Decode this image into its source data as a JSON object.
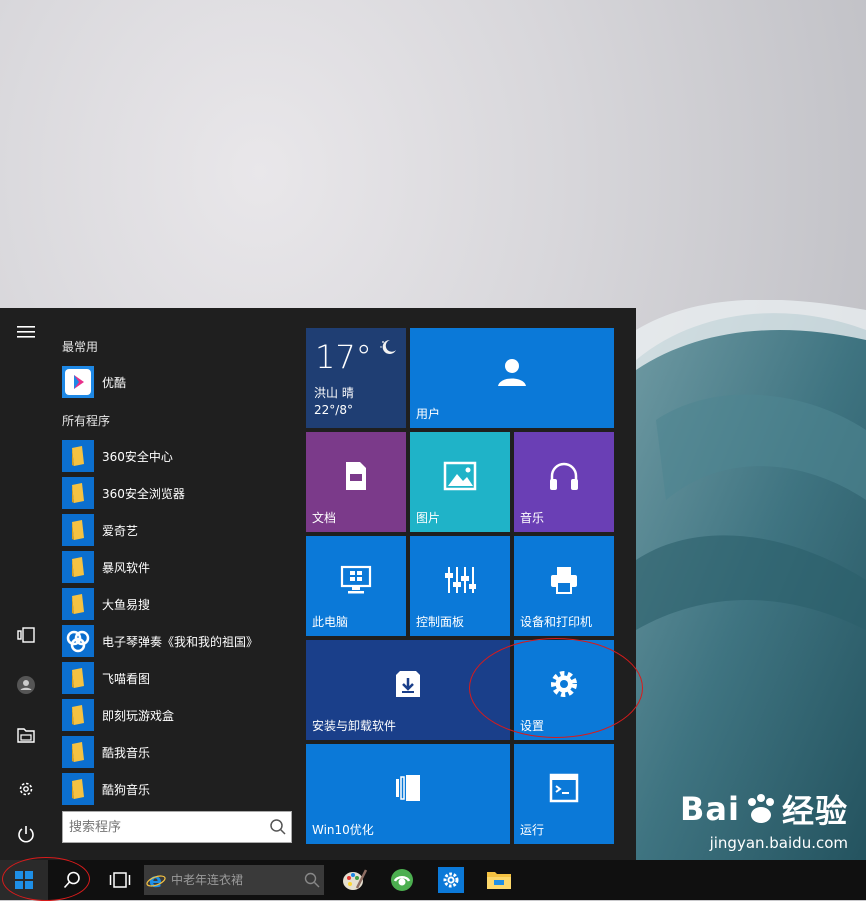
{
  "rail": {
    "items": [
      {
        "name": "hamburger-menu-icon"
      },
      {
        "name": "tablet-mode-icon"
      },
      {
        "name": "user-account-icon"
      },
      {
        "name": "file-explorer-icon"
      },
      {
        "name": "settings-gear-icon"
      },
      {
        "name": "power-icon"
      }
    ]
  },
  "apps": {
    "most_used_label": "最常用",
    "all_programs_label": "所有程序",
    "most_used": [
      {
        "label": "优酷",
        "icon": "youku-icon"
      }
    ],
    "all": [
      {
        "label": "360安全中心",
        "icon": "folder-icon"
      },
      {
        "label": "360安全浏览器",
        "icon": "folder-icon"
      },
      {
        "label": "爱奇艺",
        "icon": "folder-icon"
      },
      {
        "label": "暴风软件",
        "icon": "folder-icon"
      },
      {
        "label": "大鱼易搜",
        "icon": "folder-icon"
      },
      {
        "label": "电子琴弹奏《我和我的祖国》",
        "icon": "piano-app-icon"
      },
      {
        "label": "飞喵看图",
        "icon": "folder-icon"
      },
      {
        "label": "即刻玩游戏盒",
        "icon": "folder-icon"
      },
      {
        "label": "酷我音乐",
        "icon": "folder-icon"
      },
      {
        "label": "酷狗音乐",
        "icon": "folder-icon"
      }
    ]
  },
  "search": {
    "placeholder": "搜索程序"
  },
  "weather": {
    "temp": "17°",
    "city": "洪山",
    "condition": "晴",
    "range": "22°/8°"
  },
  "tiles": {
    "user": "用户",
    "documents": "文档",
    "pictures": "图片",
    "music": "音乐",
    "this_pc": "此电脑",
    "control_panel": "控制面板",
    "devices_printers": "设备和打印机",
    "install_uninstall": "安装与卸载软件",
    "settings": "设置",
    "win10_optimize": "Win10优化",
    "run": "运行"
  },
  "taskbar": {
    "search_placeholder": "中老年连衣裙"
  },
  "colors": {
    "accent": "#0b79d8",
    "purple": "#7b3a8a",
    "teal": "#1fb3c8",
    "violet": "#6a3fb5",
    "darkblue": "#1a3f8a",
    "weather": "#1f3e73",
    "annotation": "#d81b1b"
  },
  "watermark": {
    "brand_a": "Bai",
    "brand_b": "经验",
    "url": "jingyan.baidu.com"
  }
}
